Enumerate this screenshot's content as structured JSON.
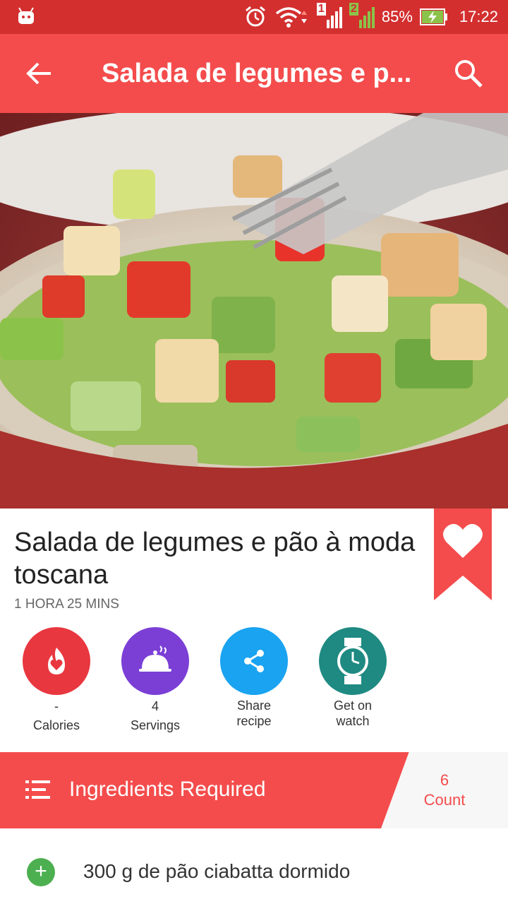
{
  "status": {
    "battery": "85%",
    "time": "17:22",
    "sim1": "1",
    "sim2": "2"
  },
  "appbar": {
    "title": "Salada de legumes e p...",
    "back_icon": "arrow-left-icon",
    "search_icon": "search-icon"
  },
  "recipe": {
    "title": "Salada de legumes e pão à moda toscana",
    "time": "1 HORA 25 MINS"
  },
  "actions": [
    {
      "value": "-",
      "label": "Calories",
      "icon": "flame-heart-icon",
      "color": "#e8373f"
    },
    {
      "value": "4",
      "label": "Servings",
      "icon": "serving-dish-icon",
      "color": "#7b3fd6"
    },
    {
      "value": "",
      "label": "Share recipe",
      "icon": "share-icon",
      "color": "#1aa3f0"
    },
    {
      "value": "",
      "label": "Get on watch",
      "icon": "watch-icon",
      "color": "#1e8a82"
    }
  ],
  "ingredients_header": {
    "label": "Ingredients Required",
    "count_value": "6",
    "count_label": "Count"
  },
  "ingredients": [
    {
      "text": "300 g de pão ciabatta dormido"
    }
  ],
  "colors": {
    "status_bar": "#d32f2f",
    "primary": "#f44c4c",
    "accent_green": "#4caf50"
  }
}
